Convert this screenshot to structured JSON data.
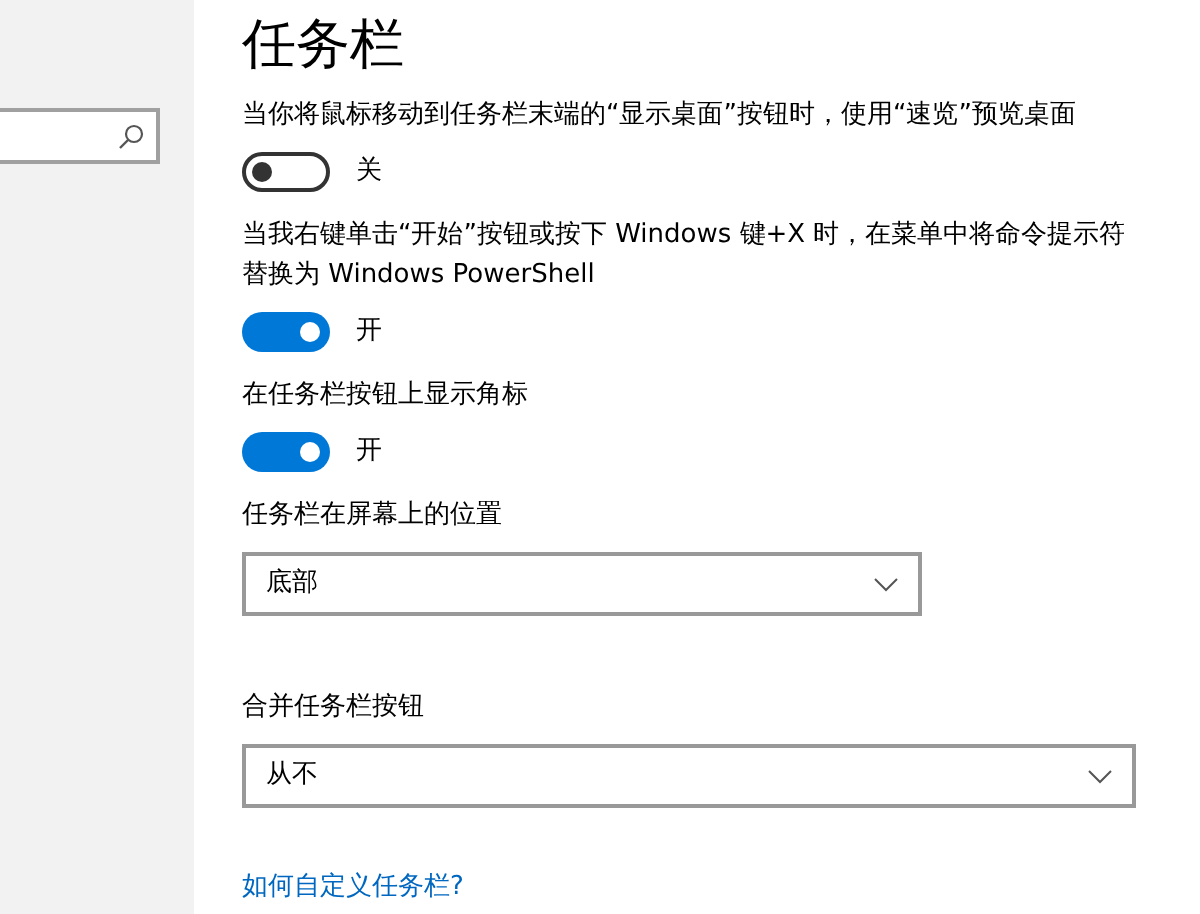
{
  "title": "任务栏",
  "settings": [
    {
      "kind": "toggle",
      "description": "当你将鼠标移动到任务栏末端的“显示桌面”按钮时，使用“速览”预览桌面",
      "on": false,
      "state_label": "关"
    },
    {
      "kind": "toggle",
      "description": "当我右键单击“开始”按钮或按下 Windows 键+X 时，在菜单中将命令提示符替换为 Windows PowerShell",
      "on": true,
      "state_label": "开"
    },
    {
      "kind": "toggle",
      "description": "在任务栏按钮上显示角标",
      "on": true,
      "state_label": "开"
    },
    {
      "kind": "dropdown",
      "description": "任务栏在屏幕上的位置",
      "value": "底部",
      "wide": false
    },
    {
      "kind": "dropdown",
      "description": "合并任务栏按钮",
      "value": "从不",
      "wide": true
    }
  ],
  "link": "如何自定义任务栏?"
}
